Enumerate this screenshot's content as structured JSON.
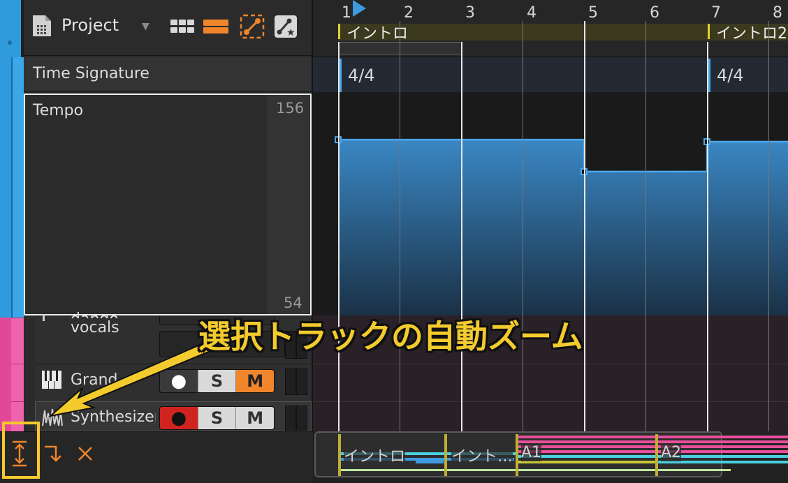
{
  "header": {
    "project_label": "Project",
    "time_signature_label": "Time Signature",
    "tempo_label": "Tempo",
    "tempo_max": "156",
    "tempo_min": "54"
  },
  "toolbar": {
    "icons": [
      "grid-view-icon",
      "list-view-icon",
      "automation-edit-icon",
      "automation-star-icon"
    ],
    "accent_color": "#f0852b"
  },
  "ruler": {
    "bars": [
      "1",
      "2",
      "3",
      "4",
      "5",
      "6",
      "7",
      "8"
    ],
    "cues": [
      "イントロ",
      "イントロ2"
    ]
  },
  "time_signature_lane": {
    "values": [
      "4/4",
      "4/4"
    ]
  },
  "tempo_automation": {
    "color": "#4aa6ea",
    "points": [
      {
        "bar": 1,
        "level": 0.88
      },
      {
        "bar": 5,
        "level": 0.88
      },
      {
        "bar": 5,
        "level": 0.72
      },
      {
        "bar": 7,
        "level": 0.72
      },
      {
        "bar": 7,
        "level": 0.87
      }
    ]
  },
  "tracks": [
    {
      "name_line1": "dango_",
      "name_line2": "vocals"
    },
    {
      "name": "Grand",
      "record": "●",
      "solo": "S",
      "mute": "M",
      "mute_active": true
    },
    {
      "name": "Synthesizer",
      "record": "●",
      "solo": "S",
      "mute": "M",
      "record_active": true
    }
  ],
  "bottom_bar": {
    "icons": [
      "zoom-to-selection-icon",
      "follow-arrow-icon",
      "close-icon"
    ],
    "highlight_color": "#f3c92b"
  },
  "overview": {
    "sections": [
      "イントロ",
      "イント…",
      "A1",
      "A2"
    ]
  },
  "annotation": {
    "text": "選択トラックの自動ズーム",
    "color": "#f3cb2d"
  }
}
